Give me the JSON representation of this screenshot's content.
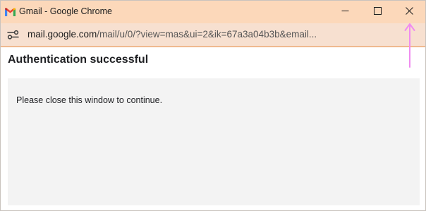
{
  "window": {
    "title": "Gmail - Google Chrome",
    "app_icon": "gmail-icon",
    "controls": {
      "minimize_icon": "minimize-icon",
      "maximize_icon": "maximize-icon",
      "close_icon": "close-icon"
    }
  },
  "address_bar": {
    "site_info_icon": "site-info-icon",
    "url_host": "mail.google.com",
    "url_path": "/mail/u/0/?view=mas&ui=2&ik=67a3a04b3b&email..."
  },
  "page": {
    "title": "Authentication successful",
    "message": "Please close this window to continue."
  },
  "colors": {
    "titlebar": "#fcd8ba",
    "addressbar": "#f7e0d0",
    "separator": "#efb98f",
    "panel": "#f3f3f3",
    "annotation": "#f08cf0"
  }
}
